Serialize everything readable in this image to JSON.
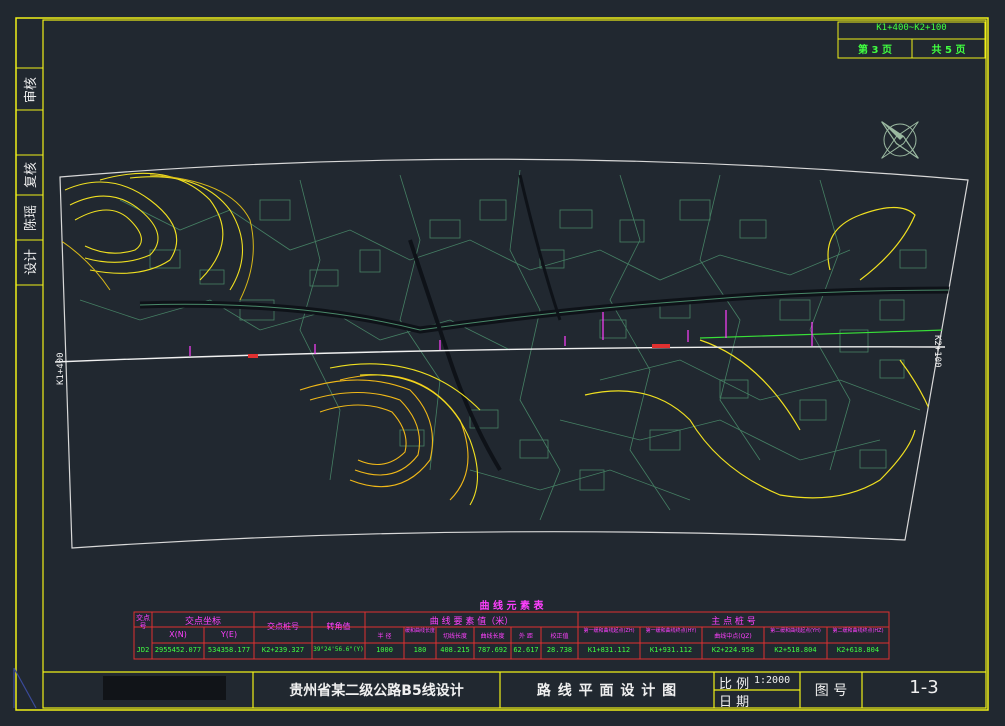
{
  "sheet": {
    "range": "K1+400~K2+100",
    "page_label": "第 3 页",
    "total_label": "共 5 页"
  },
  "side_block": {
    "shen_he": "审核",
    "fu_he": "复核",
    "name": "陈瑶",
    "she_ji": "设计"
  },
  "stations": {
    "start": "K1+400",
    "end": "K2+100"
  },
  "curve_table": {
    "title": "曲 线 元 素 表",
    "groups": {
      "jd_no": "交点号",
      "coord": "交点坐标",
      "station": "交点桩号",
      "deflection": "转角值",
      "curve_elements": "曲 线 要 素 值（米）",
      "main_points": "主 点 桩 号"
    },
    "sub_headers": [
      "X(N)",
      "Y(E)",
      "半 径",
      "缓和曲线长度",
      "切线长度",
      "曲线长度",
      "外 距",
      "校正值",
      "第一缓和曲线起点(ZH)",
      "第一缓和曲线终点(HY)",
      "曲线中点(QZ)",
      "第二缓和曲线起点(YH)",
      "第二缓和曲线终点(HZ)"
    ],
    "row": [
      "JD2",
      "2955452.077",
      "534358.177",
      "K2+239.327",
      "39°24'56.6\"(Y)",
      "1000",
      "180",
      "408.215",
      "787.692",
      "62.617",
      "28.738",
      "K1+831.112",
      "K1+931.112",
      "K2+224.958",
      "K2+518.804",
      "K2+618.804"
    ]
  },
  "title_block": {
    "project": "贵州省某二级公路B5线设计",
    "drawing": "路 线 平 面 设 计 图",
    "scale_label": "比 例",
    "scale_value": "1:2000",
    "date_label": "日 期",
    "drawing_no_label": "图 号",
    "drawing_no": "1-3"
  },
  "colors": {
    "background": "#212830",
    "frame": "#f0f018",
    "table_red": "#e03030",
    "magenta": "#ff40ff",
    "green_text": "#40ff40",
    "terrain": "#4a8a6a",
    "contour_yellow": "#f0e020"
  }
}
